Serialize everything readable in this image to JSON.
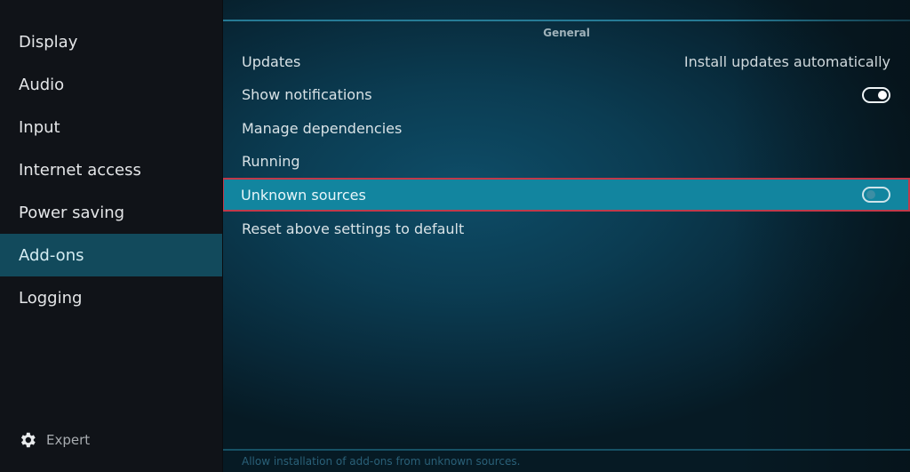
{
  "sidebar": {
    "items": [
      {
        "label": "Display"
      },
      {
        "label": "Audio"
      },
      {
        "label": "Input"
      },
      {
        "label": "Internet access"
      },
      {
        "label": "Power saving"
      },
      {
        "label": "Add-ons",
        "active": true
      },
      {
        "label": "Logging"
      }
    ],
    "level_button": {
      "icon": "gear-icon",
      "label": "Expert"
    }
  },
  "main": {
    "section_title": "General",
    "settings": [
      {
        "label": "Updates",
        "value": "Install updates automatically"
      },
      {
        "label": "Show notifications",
        "toggle": "on"
      },
      {
        "label": "Manage dependencies"
      },
      {
        "label": "Running"
      },
      {
        "label": "Unknown sources",
        "toggle": "off",
        "focused": true
      },
      {
        "label": "Reset above settings to default"
      }
    ],
    "help_text": "Allow installation of add-ons from unknown sources."
  },
  "colors": {
    "focus_background": "#12859f",
    "focus_border": "#c0394a",
    "active_sidebar": "#124a5c"
  }
}
